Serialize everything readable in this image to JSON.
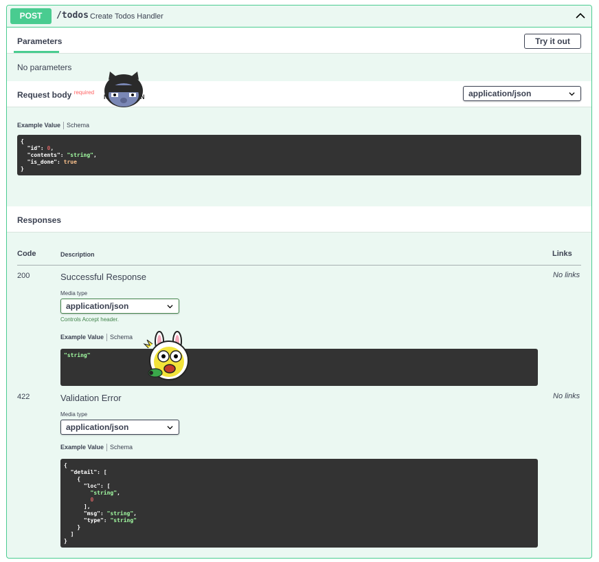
{
  "endpoint": {
    "method": "POST",
    "path": "/todos",
    "summary": "Create Todos Handler"
  },
  "parameters": {
    "tab_label": "Parameters",
    "try_button": "Try it out",
    "empty_text": "No parameters"
  },
  "request_body": {
    "title": "Request body",
    "required_label": "required",
    "content_type": "application/json",
    "example_tab": "Example Value",
    "schema_tab": "Schema",
    "example_lines": [
      [
        {
          "t": "{",
          "c": "k"
        }
      ],
      [
        {
          "t": "  \"id\"",
          "c": "k"
        },
        {
          "t": ": ",
          "c": "k"
        },
        {
          "t": "0",
          "c": "n"
        },
        {
          "t": ",",
          "c": "k"
        }
      ],
      [
        {
          "t": "  \"contents\"",
          "c": "k"
        },
        {
          "t": ": ",
          "c": "k"
        },
        {
          "t": "\"string\"",
          "c": "s"
        },
        {
          "t": ",",
          "c": "k"
        }
      ],
      [
        {
          "t": "  \"is_done\"",
          "c": "k"
        },
        {
          "t": ": ",
          "c": "k"
        },
        {
          "t": "true",
          "c": "b"
        }
      ],
      [
        {
          "t": "}",
          "c": "k"
        }
      ]
    ]
  },
  "responses": {
    "title": "Responses",
    "col_code": "Code",
    "col_description": "Description",
    "col_links": "Links",
    "items": [
      {
        "code": "200",
        "description": "Successful Response",
        "media_type_label": "Media type",
        "media_type": "application/json",
        "controls_note": "Controls Accept header.",
        "example_tab": "Example Value",
        "schema_tab": "Schema",
        "links": "No links",
        "example_lines": [
          [
            {
              "t": "\"string\"",
              "c": "s"
            }
          ]
        ]
      },
      {
        "code": "422",
        "description": "Validation Error",
        "media_type_label": "Media type",
        "media_type": "application/json",
        "example_tab": "Example Value",
        "schema_tab": "Schema",
        "links": "No links",
        "example_lines": [
          [
            {
              "t": "{",
              "c": "k"
            }
          ],
          [
            {
              "t": "  \"detail\"",
              "c": "k"
            },
            {
              "t": ": [",
              "c": "k"
            }
          ],
          [
            {
              "t": "    {",
              "c": "k"
            }
          ],
          [
            {
              "t": "      \"loc\"",
              "c": "k"
            },
            {
              "t": ": [",
              "c": "k"
            }
          ],
          [
            {
              "t": "        \"string\"",
              "c": "s"
            },
            {
              "t": ",",
              "c": "k"
            }
          ],
          [
            {
              "t": "        0",
              "c": "n"
            }
          ],
          [
            {
              "t": "      ],",
              "c": "k"
            }
          ],
          [
            {
              "t": "      \"msg\"",
              "c": "k"
            },
            {
              "t": ": ",
              "c": "k"
            },
            {
              "t": "\"string\"",
              "c": "s"
            },
            {
              "t": ",",
              "c": "k"
            }
          ],
          [
            {
              "t": "      \"type\"",
              "c": "k"
            },
            {
              "t": ": ",
              "c": "k"
            },
            {
              "t": "\"string\"",
              "c": "s"
            }
          ],
          [
            {
              "t": "    }",
              "c": "k"
            }
          ],
          [
            {
              "t": "  ]",
              "c": "k"
            }
          ],
          [
            {
              "t": "}",
              "c": "k"
            }
          ]
        ]
      }
    ]
  },
  "colors": {
    "post_accent": "#49cc90",
    "post_background": "#ebf8f2",
    "code_background": "#333333"
  },
  "icons": [
    "chevron-up-icon",
    "chevron-down-icon",
    "cat-sticker",
    "rabbit-sticker"
  ]
}
